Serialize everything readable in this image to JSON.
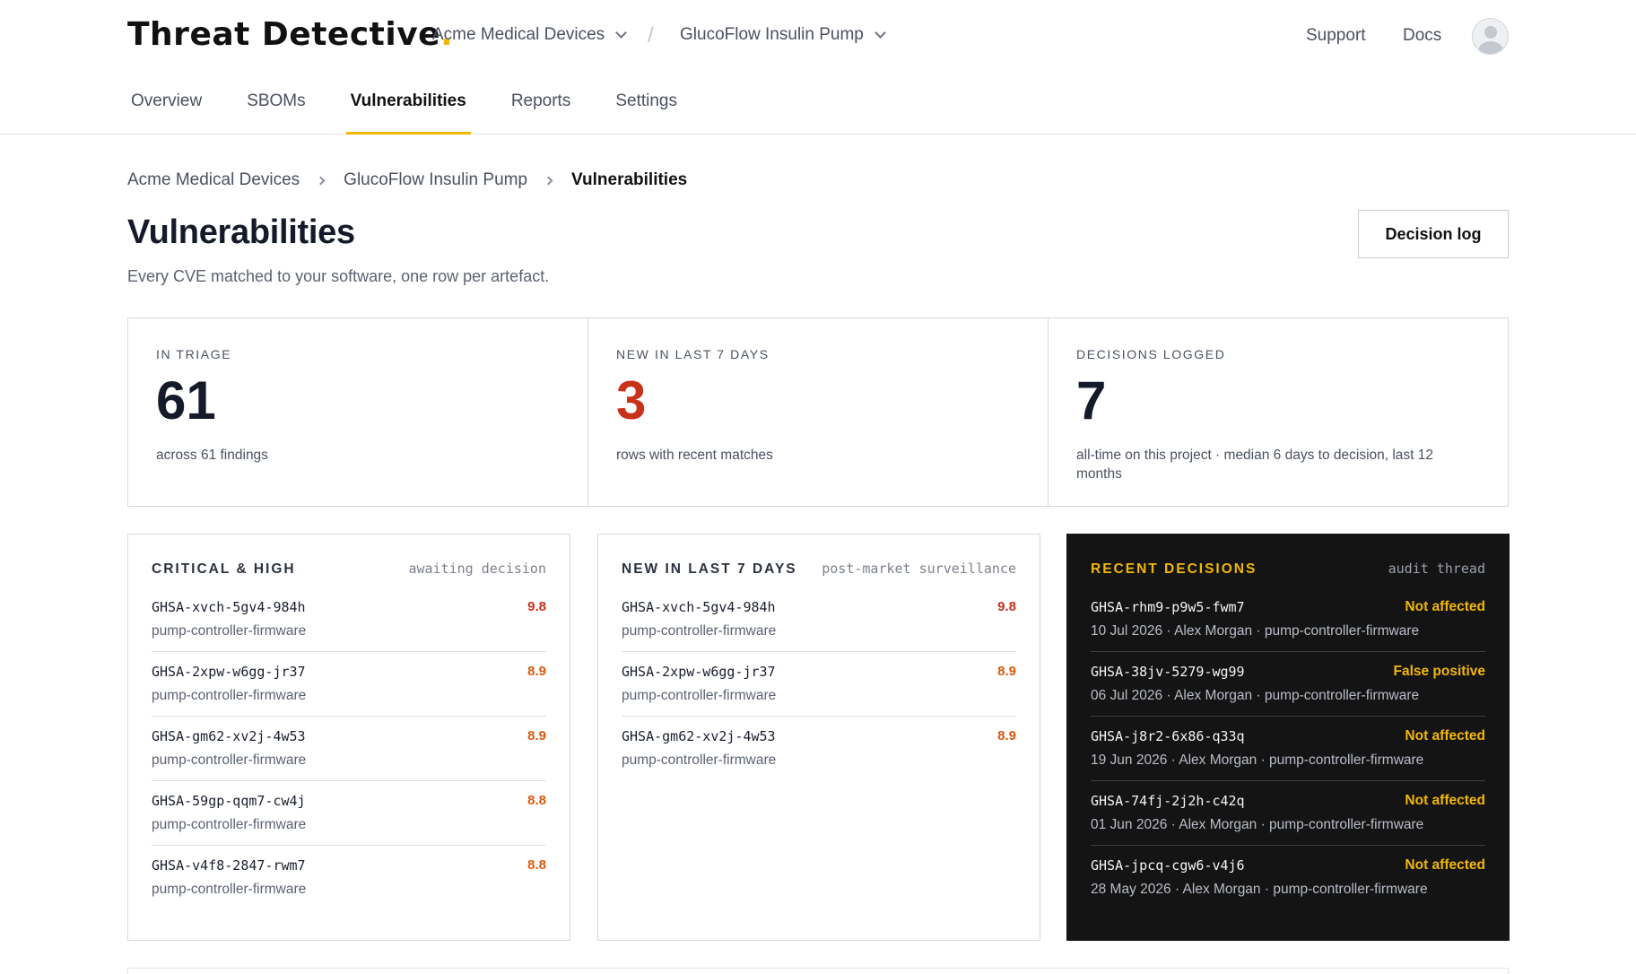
{
  "app": {
    "brand_part1": "Threat",
    "brand_part2": "Detective",
    "org": "Acme Medical Devices",
    "product": "GlucoFlow Insulin Pump",
    "support": "Support",
    "docs": "Docs"
  },
  "tabs": [
    {
      "label": "Overview"
    },
    {
      "label": "SBOMs"
    },
    {
      "label": "Vulnerabilities"
    },
    {
      "label": "Reports"
    },
    {
      "label": "Settings"
    }
  ],
  "breadcrumb": [
    "Acme Medical Devices",
    "GlucoFlow Insulin Pump",
    "Vulnerabilities"
  ],
  "page": {
    "title": "Vulnerabilities",
    "subtitle": "Every CVE matched to your software, one row per artefact.",
    "decision_log_button": "Decision log"
  },
  "stats": [
    {
      "label": "IN TRIAGE",
      "value": "61",
      "note": "across 61 findings"
    },
    {
      "label": "NEW IN LAST 7 DAYS",
      "value": "3",
      "note": "rows with recent matches"
    },
    {
      "label": "DECISIONS LOGGED",
      "value": "7",
      "note": "all-time on this project · median 6 days to decision, last 12 months"
    }
  ],
  "critical_high": {
    "title": "CRITICAL & HIGH",
    "subtitle": "awaiting decision",
    "rows": [
      {
        "id": "GHSA-xvch-5gv4-984h",
        "artefact": "pump-controller-firmware",
        "score": "9.8"
      },
      {
        "id": "GHSA-2xpw-w6gg-jr37",
        "artefact": "pump-controller-firmware",
        "score": "8.9"
      },
      {
        "id": "GHSA-gm62-xv2j-4w53",
        "artefact": "pump-controller-firmware",
        "score": "8.9"
      },
      {
        "id": "GHSA-59gp-qqm7-cw4j",
        "artefact": "pump-controller-firmware",
        "score": "8.8"
      },
      {
        "id": "GHSA-v4f8-2847-rwm7",
        "artefact": "pump-controller-firmware",
        "score": "8.8"
      }
    ]
  },
  "new_last_7": {
    "title": "NEW IN LAST 7 DAYS",
    "subtitle": "post-market surveillance",
    "rows": [
      {
        "id": "GHSA-xvch-5gv4-984h",
        "artefact": "pump-controller-firmware",
        "score": "9.8"
      },
      {
        "id": "GHSA-2xpw-w6gg-jr37",
        "artefact": "pump-controller-firmware",
        "score": "8.9"
      },
      {
        "id": "GHSA-gm62-xv2j-4w53",
        "artefact": "pump-controller-firmware",
        "score": "8.9"
      }
    ]
  },
  "recent_decisions": {
    "title": "RECENT DECISIONS",
    "subtitle": "audit thread",
    "rows": [
      {
        "id": "GHSA-rhm9-p9w5-fwm7",
        "meta": "10 Jul 2026 · Alex Morgan · pump-controller-firmware",
        "verdict": "Not affected"
      },
      {
        "id": "GHSA-38jv-5279-wg99",
        "meta": "06 Jul 2026 · Alex Morgan · pump-controller-firmware",
        "verdict": "False positive"
      },
      {
        "id": "GHSA-j8r2-6x86-q33q",
        "meta": "19 Jun 2026 · Alex Morgan · pump-controller-firmware",
        "verdict": "Not affected"
      },
      {
        "id": "GHSA-74fj-2j2h-c42q",
        "meta": "01 Jun 2026 · Alex Morgan · pump-controller-firmware",
        "verdict": "Not affected"
      },
      {
        "id": "GHSA-jpcq-cgw6-v4j6",
        "meta": "28 May 2026 · Alex Morgan · pump-controller-firmware",
        "verdict": "Not affected"
      }
    ]
  },
  "colors": {
    "accent": "#f2b705",
    "critical": "#c8311a",
    "high": "#d9590f",
    "dark_card": "#141414"
  }
}
